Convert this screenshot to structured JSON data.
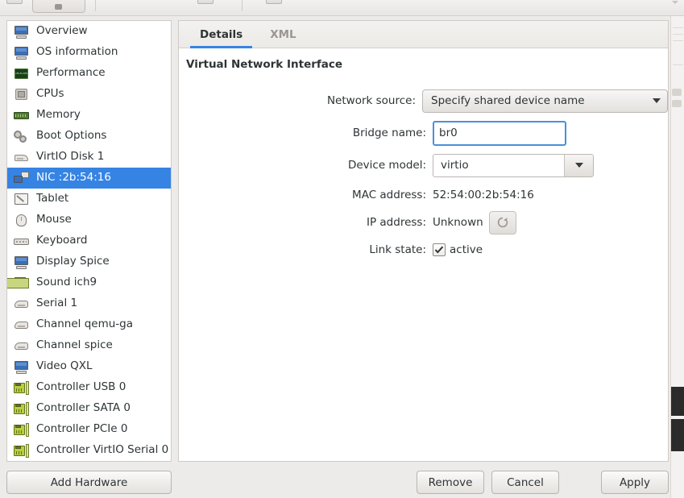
{
  "toolbar": {
    "icons": [
      "console-icon",
      "run-icon",
      "pause-icon",
      "shutdown-icon"
    ],
    "overflow_icon": "chevron-down-icon"
  },
  "sidebar": {
    "items": [
      {
        "label": "Overview",
        "icon": "monitor-icon",
        "selected": false
      },
      {
        "label": "OS information",
        "icon": "monitor-icon",
        "selected": false
      },
      {
        "label": "Performance",
        "icon": "performance-icon",
        "selected": false
      },
      {
        "label": "CPUs",
        "icon": "cpu-icon",
        "selected": false
      },
      {
        "label": "Memory",
        "icon": "memory-icon",
        "selected": false
      },
      {
        "label": "Boot Options",
        "icon": "gear-icon",
        "selected": false
      },
      {
        "label": "VirtIO Disk 1",
        "icon": "disk-icon",
        "selected": false
      },
      {
        "label": "NIC :2b:54:16",
        "icon": "nic-icon",
        "selected": true
      },
      {
        "label": "Tablet",
        "icon": "tablet-icon",
        "selected": false
      },
      {
        "label": "Mouse",
        "icon": "mouse-icon",
        "selected": false
      },
      {
        "label": "Keyboard",
        "icon": "keyboard-icon",
        "selected": false
      },
      {
        "label": "Display Spice",
        "icon": "monitor-icon",
        "selected": false
      },
      {
        "label": "Sound ich9",
        "icon": "sound-icon",
        "selected": false
      },
      {
        "label": "Serial 1",
        "icon": "serial-icon",
        "selected": false
      },
      {
        "label": "Channel qemu-ga",
        "icon": "serial-icon",
        "selected": false
      },
      {
        "label": "Channel spice",
        "icon": "serial-icon",
        "selected": false
      },
      {
        "label": "Video QXL",
        "icon": "monitor-icon",
        "selected": false
      },
      {
        "label": "Controller USB 0",
        "icon": "controller-icon",
        "selected": false
      },
      {
        "label": "Controller SATA 0",
        "icon": "controller-icon",
        "selected": false
      },
      {
        "label": "Controller PCIe 0",
        "icon": "controller-icon",
        "selected": false
      },
      {
        "label": "Controller VirtIO Serial 0",
        "icon": "controller-icon",
        "selected": false
      }
    ],
    "add_hardware_label": "Add Hardware"
  },
  "details": {
    "tabs": [
      {
        "label": "Details",
        "active": true
      },
      {
        "label": "XML",
        "active": false
      }
    ],
    "section_title": "Virtual Network Interface",
    "fields": {
      "network_source": {
        "label": "Network source:",
        "value": "Specify shared device name"
      },
      "bridge_name": {
        "label": "Bridge name:",
        "value": "br0",
        "placeholder": ""
      },
      "device_model": {
        "label": "Device model:",
        "value": "virtio"
      },
      "mac_address": {
        "label": "MAC address:",
        "value": "52:54:00:2b:54:16"
      },
      "ip_address": {
        "label": "IP address:",
        "value": "Unknown",
        "refresh_icon": "refresh-icon"
      },
      "link_state": {
        "label": "Link state:",
        "checkbox_label": "active",
        "checked": true
      }
    }
  },
  "actions": {
    "remove_label": "Remove",
    "cancel_label": "Cancel",
    "apply_label": "Apply"
  },
  "colors": {
    "selection": "#3584e4",
    "accent_underline": "#3584e4",
    "focus_border": "#4a90d9",
    "window_bg": "#edebe9"
  }
}
